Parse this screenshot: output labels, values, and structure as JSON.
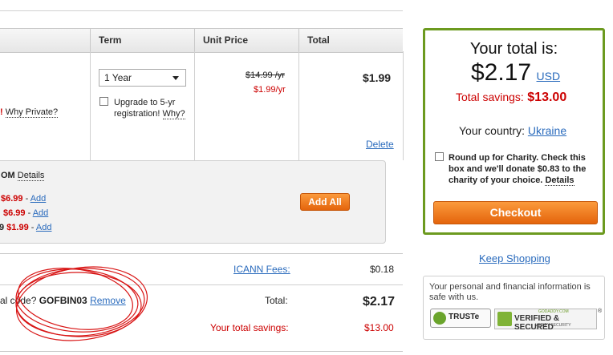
{
  "table": {
    "headers": {
      "term": "Term",
      "unit_price": "Unit Price",
      "total": "Total"
    },
    "row1": {
      "private_prefix": "!",
      "why_private": "Why Private?",
      "term_value": "1 Year",
      "upgrade_label_1": "Upgrade to 5-yr",
      "upgrade_label_2": "registration!",
      "upgrade_why": "Why?",
      "old_price": "$14.99 /yr",
      "new_price": "$1.99/yr",
      "total": "$1.99",
      "delete": "Delete"
    }
  },
  "suggestions": {
    "title_fragment": "OM",
    "details": "Details",
    "items": [
      {
        "price": "$6.99",
        "sep": " - ",
        "add": "Add"
      },
      {
        "price": "$6.99",
        "sep": " - ",
        "add": "Add"
      },
      {
        "prefix": "9",
        "price": "$1.99",
        "sep": " - ",
        "add": "Add"
      }
    ],
    "add_all": "Add All"
  },
  "summary": {
    "icann_label": "ICANN Fees:",
    "icann_value": "$0.18",
    "promo_prefix": "al code?",
    "promo_code": "GOFBIN03",
    "remove": "Remove",
    "total_label": "Total:",
    "total_value": "$2.17",
    "savings_label": "Your total savings:",
    "savings_value": "$13.00"
  },
  "total_box": {
    "heading": "Your total is:",
    "amount": "$2.17",
    "currency": "USD",
    "savings_label": "Total savings:",
    "savings_value": "$13.00",
    "country_label": "Your country:",
    "country_value": "Ukraine",
    "charity_text": "Round up for Charity. Check this box and we'll donate $0.83 to the charity of your choice.",
    "charity_details": "Details",
    "checkout": "Checkout"
  },
  "keep_shopping": "Keep Shopping",
  "secure": {
    "text": "Your personal and financial information is safe with us.",
    "truste": "TRUSTe",
    "godaddy_top": "GODADDY.COM",
    "godaddy_main": "VERIFIED & SECURED",
    "godaddy_sub": "VERIFY SECURITY"
  },
  "colors": {
    "accent_green": "#6c9a1f",
    "orange": "#f0801f",
    "red": "#cc0000",
    "link": "#2a6bbd"
  }
}
